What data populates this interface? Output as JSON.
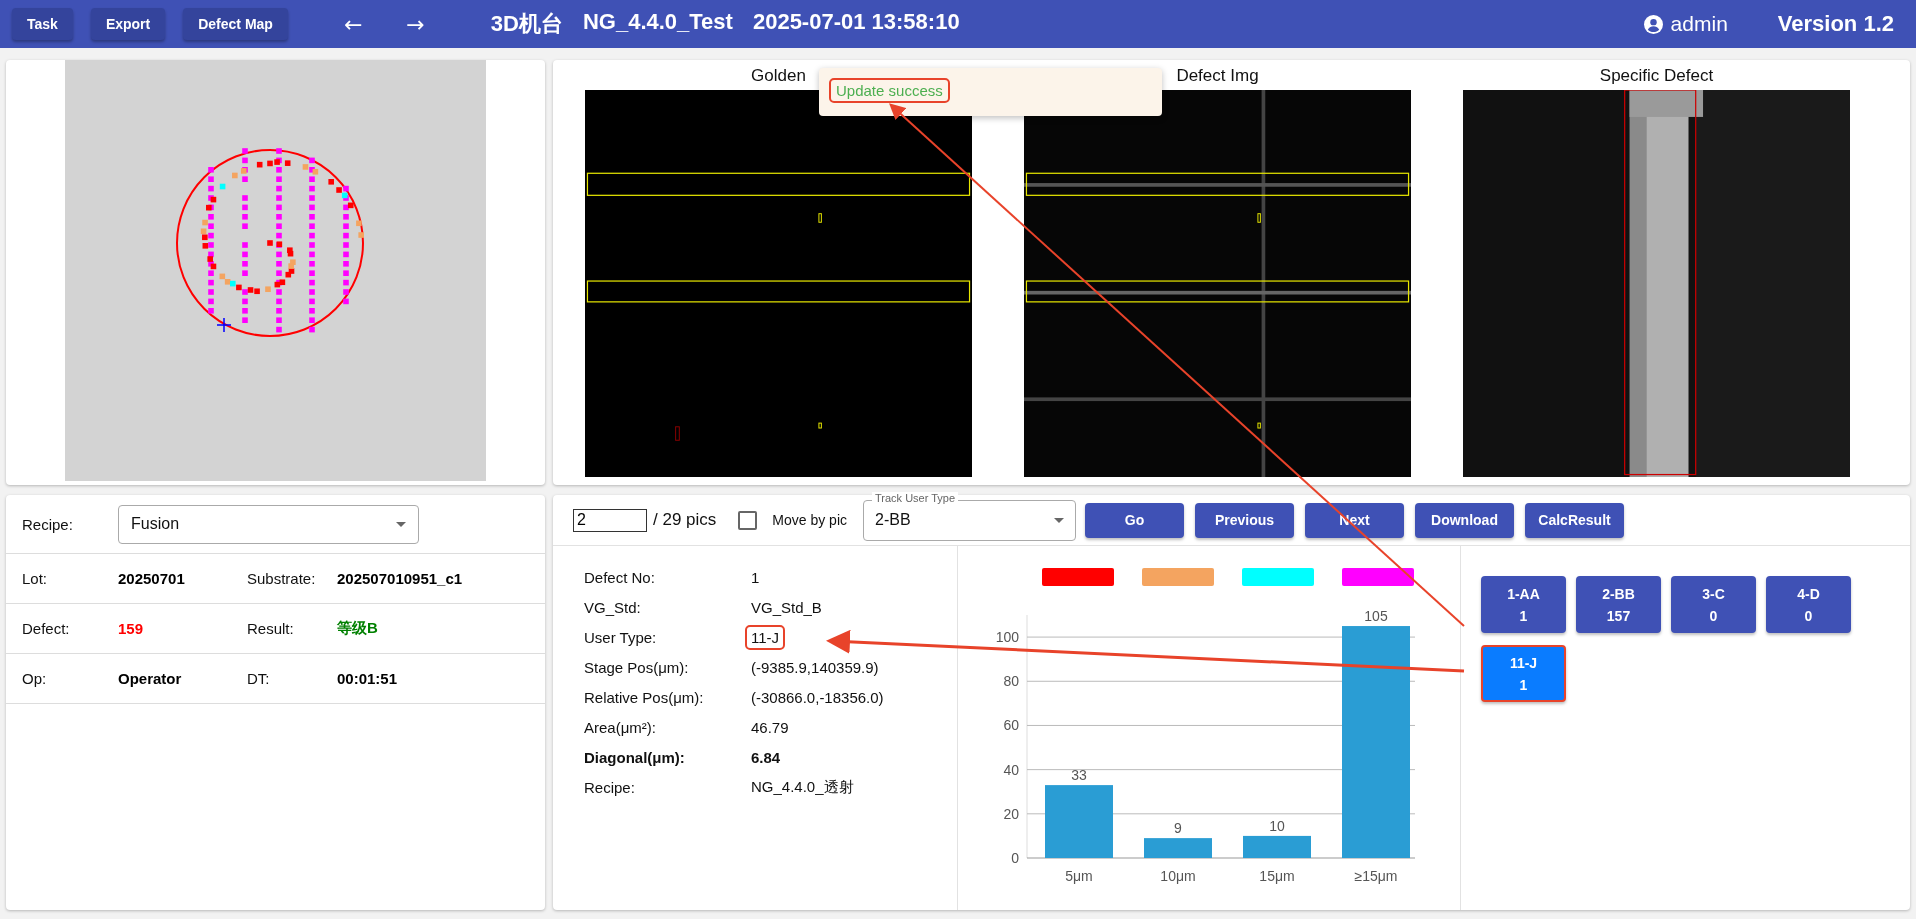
{
  "top_bar": {
    "buttons": [
      "Task",
      "Export",
      "Defect Map"
    ],
    "nav": [
      "←",
      "→"
    ],
    "title": [
      "3D机台",
      "NG_4.4.0_Test",
      "2025-07-01 13:58:10"
    ],
    "user": "admin",
    "version": "Version 1.2"
  },
  "toast": {
    "message": "Update success",
    "annotated": true
  },
  "images": [
    {
      "title": "Golden",
      "kind": "golden"
    },
    {
      "title": "Defect Img",
      "kind": "defect"
    },
    {
      "title": "Specific Defect",
      "kind": "specific"
    }
  ],
  "summary": {
    "recipe": {
      "label": "Recipe:",
      "value": "Fusion"
    },
    "rows": [
      [
        {
          "label": "Lot:",
          "value": "20250701",
          "color": "#000000"
        },
        {
          "label": "Substrate:",
          "value": "202507010951_c1",
          "color": "#000000"
        }
      ],
      [
        {
          "label": "Defect:",
          "value": "159",
          "color": "#ff0000"
        },
        {
          "label": "Result:",
          "value": "等级B",
          "color": "#008000"
        }
      ],
      [
        {
          "label": "Op:",
          "value": "Operator",
          "color": "#000000"
        },
        {
          "label": "DT:",
          "value": "00:01:51",
          "color": "#000000"
        }
      ]
    ]
  },
  "toolbar": {
    "page": "2",
    "total": "/ 29 pics",
    "move_by_pic": {
      "label": "Move by pic",
      "checked": false
    },
    "track_type": {
      "label": "Track User Type",
      "value": "2-BB"
    },
    "buttons": [
      "Go",
      "Previous",
      "Next",
      "Download",
      "CalcResult"
    ]
  },
  "details": [
    {
      "label": "Defect No:",
      "value": "1",
      "bold": false,
      "annotated": false
    },
    {
      "label": "VG_Std:",
      "value": "VG_Std_B",
      "bold": false,
      "annotated": false
    },
    {
      "label": "User Type:",
      "value": "11-J",
      "bold": false,
      "annotated": true
    },
    {
      "label": "Stage Pos(μm):",
      "value": "(-9385.9,140359.9)",
      "bold": false,
      "annotated": false
    },
    {
      "label": "Relative Pos(μm):",
      "value": "(-30866.0,-18356.0)",
      "bold": false,
      "annotated": false
    },
    {
      "label": "Area(μm²):",
      "value": "46.79",
      "bold": false,
      "annotated": false
    },
    {
      "label": "Diagonal(μm):",
      "value": "6.84",
      "bold": true,
      "annotated": false
    },
    {
      "label": "Recipe:",
      "value": "NG_4.4.0_透射",
      "bold": false,
      "annotated": false
    }
  ],
  "legend": [
    {
      "color": "#ff0000"
    },
    {
      "color": "#f4a460"
    },
    {
      "color": "#00ffff"
    },
    {
      "color": "#ff00ff"
    }
  ],
  "chart_data": {
    "type": "bar",
    "categories": [
      "5μm",
      "10μm",
      "15μm",
      "≥15μm"
    ],
    "values": [
      33,
      9,
      10,
      105
    ],
    "grid": true,
    "ylim": [
      0,
      110
    ],
    "yticks": [
      0,
      20,
      40,
      60,
      80,
      100
    ],
    "data_labels": true
  },
  "type_buttons": [
    {
      "code": "1-AA",
      "count": "1",
      "selected": false,
      "annotated": false
    },
    {
      "code": "2-BB",
      "count": "157",
      "selected": false,
      "annotated": false
    },
    {
      "code": "3-C",
      "count": "0",
      "selected": false,
      "annotated": false
    },
    {
      "code": "4-D",
      "count": "0",
      "selected": false,
      "annotated": false
    },
    {
      "code": "11-J",
      "count": "1",
      "selected": true,
      "annotated": true
    }
  ]
}
